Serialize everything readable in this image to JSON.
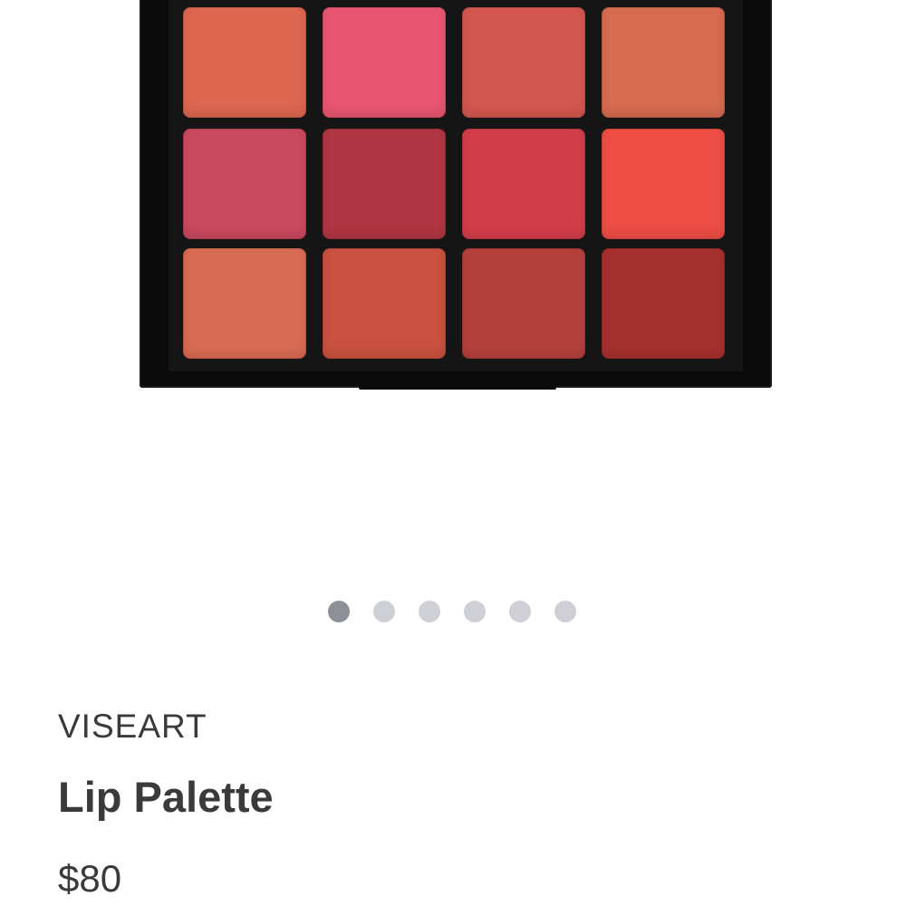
{
  "product": {
    "brand": "VISEART",
    "name": "Lip Palette",
    "price": "$80"
  },
  "carousel": {
    "total": 6,
    "active_index": 0
  },
  "palette": {
    "rows": 3,
    "columns": 4,
    "shades": [
      "#dd6650",
      "#e75570",
      "#d2574f",
      "#d66b50",
      "#c9495e",
      "#b03643",
      "#d33c4a",
      "#ec4d45",
      "#d96a53",
      "#c9513f",
      "#b4403c",
      "#a6302f"
    ]
  },
  "colors": {
    "text": "#3a3a3a",
    "dot_inactive": "#cfd0d6",
    "dot_active": "#8e9098",
    "palette_case": "#0b0b0b"
  }
}
